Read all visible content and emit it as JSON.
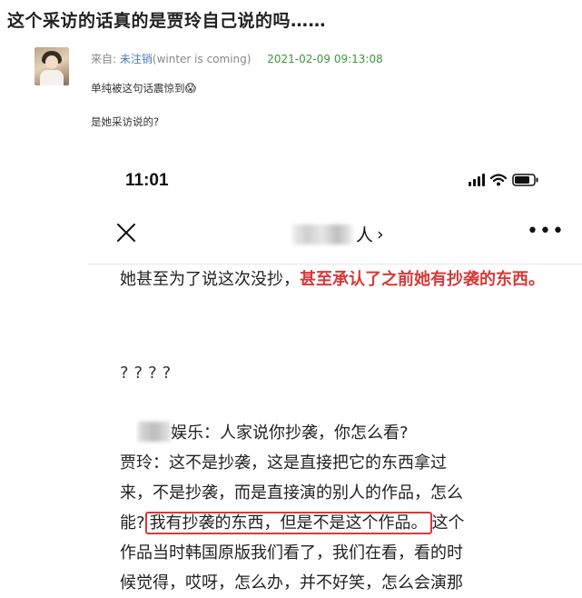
{
  "post": {
    "title": "这个采访的话真的是贾玲自己说的吗……",
    "from_label": "来自:",
    "author": "未注销",
    "handle": "(winter is coming)",
    "date": "2021-02-09 09:13:08",
    "line1": "单纯被这句话震惊到",
    "line1_emoji": "😱",
    "line2": "是她采访说的?"
  },
  "phone": {
    "time": "11:01",
    "nav_title_suffix": "人",
    "nav_chevron": "›",
    "nav_more": "•••",
    "para1_normal": "她甚至为了说这次没抄，",
    "para1_red": "甚至承认了之前她有抄袭的东西。",
    "questions": "????",
    "article": {
      "l1_rest": "娱乐：人家说你抄袭，你怎么看?",
      "l2": "贾玲：这不是抄袭，这是直接把它的东西拿过",
      "l3": "来，不是抄袭，而是直接演的别人的作品，怎么",
      "l4_pre": "能?",
      "l4_box": "我有抄袭的东西，但是不是这个作品。",
      "l4_post": "这个",
      "l5": "作品当时韩国原版我们看了，我们在看，看的时",
      "l6": "候觉得，哎呀，怎么办，并不好笑，怎么会演那"
    }
  },
  "colors": {
    "highlight_red": "#d63a3a",
    "author_blue": "#4a7fc0",
    "date_green": "#3a9a3a"
  },
  "icons": {
    "close": "close-icon",
    "signal": "signal-icon",
    "wifi": "wifi-icon",
    "battery": "battery-icon",
    "more": "more-icon",
    "chevron": "chevron-right-icon"
  }
}
